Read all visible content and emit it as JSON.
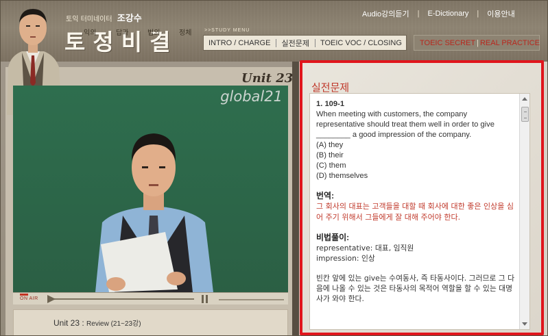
{
  "header": {
    "tagline_prefix": "토익 터미네이터",
    "tagline_name": "조강수",
    "title_chars": "토정비결",
    "title_small": [
      "익의",
      "답과",
      "법의",
      "정체"
    ],
    "top_links": [
      "Audio강의듣기",
      "E-Dictionary",
      "이용안내"
    ],
    "study_menu_label": ">>STUDY MENU",
    "menu": [
      "INTRO / CHARGE",
      "실전문제",
      "TOEIC VOC / CLOSING"
    ],
    "secret_menu": [
      "TOEIC SECRET",
      "REAL PRACTICE"
    ]
  },
  "player": {
    "unit_heading": "Unit 23",
    "watermark": "global21",
    "on_air": "ON AIR",
    "caption_main": "Unit 23 : ",
    "caption_sub": "Review (21~23강)"
  },
  "practice": {
    "title": "실전문제",
    "question_number": "1.  109-1",
    "question_text": "When meeting with customers, the company representative should treat them well in order to give ________ a good impression of the company.",
    "options": [
      "(A) they",
      "(B) their",
      "(C) them",
      "(D) themselves"
    ],
    "translation_head": "번역:",
    "translation": "그 회사의 대표는 고객들을 대할 때 회사에 대한 좋은 인상을 심어 주기 위해서 그들에게 잘 대해 주어야 한다.",
    "tips_head": "비법풀이:",
    "vocab": [
      "representative: 대표, 임직원",
      "impression: 인상"
    ],
    "explanation": "빈칸 앞에 있는 give는 수여동사, 즉 타동사이다. 그러므로 그 다음에 나올 수 있는 것은 타동사의 목적어 역할을 할 수 있는 대명사가 와야 한다."
  },
  "colors": {
    "accent_red": "#e0151c",
    "secret_text": "#b8271d"
  }
}
